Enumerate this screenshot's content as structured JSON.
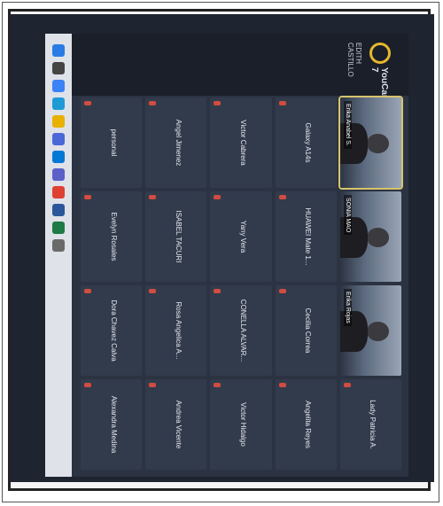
{
  "app": {
    "name": "YouCam 7",
    "user": "EDITH CASTILLO"
  },
  "participants": [
    {
      "name": "Erika Anabel S.",
      "video": true,
      "selected": true
    },
    {
      "name": "SONIA MAO",
      "video": true
    },
    {
      "name": "Erika Rojas",
      "video": true
    },
    {
      "name": "Lady Patricia A.",
      "video": false
    },
    {
      "name": "Galaxy A14s",
      "video": false
    },
    {
      "name": "HUAWEI Mate 1...",
      "video": false
    },
    {
      "name": "Cecilia Correa",
      "video": false
    },
    {
      "name": "Angelita Reyes",
      "video": false
    },
    {
      "name": "Victor Cabrera",
      "video": false
    },
    {
      "name": "Yany Vera",
      "video": false
    },
    {
      "name": "CONELLA ALVAR...",
      "video": false
    },
    {
      "name": "Victor Hidalgo",
      "video": false
    },
    {
      "name": "Angel Jimenez",
      "video": false
    },
    {
      "name": "ISABEL TACURI",
      "video": false
    },
    {
      "name": "Rosa Angelica A...",
      "video": false
    },
    {
      "name": "Andrea Vicente",
      "video": false
    },
    {
      "name": "personal",
      "video": false
    },
    {
      "name": "Evelyn Rosales",
      "video": false
    },
    {
      "name": "Dora Chavez Calva",
      "video": false
    },
    {
      "name": "Alexandra Medina",
      "video": false
    }
  ],
  "taskbar": {
    "icons": [
      "start-icon",
      "search-icon",
      "task-view-icon",
      "edge-icon",
      "files-icon",
      "store-icon",
      "mail-icon",
      "teams-icon",
      "chrome-icon",
      "word-icon",
      "excel-icon",
      "settings-icon"
    ],
    "colors": [
      "#2a7be4",
      "#444",
      "#3b82f6",
      "#1f9ad6",
      "#e8b000",
      "#4a68d8",
      "#0078d4",
      "#5b5fc7",
      "#de4032",
      "#2b579a",
      "#1d7a45",
      "#6a6a6a"
    ]
  }
}
